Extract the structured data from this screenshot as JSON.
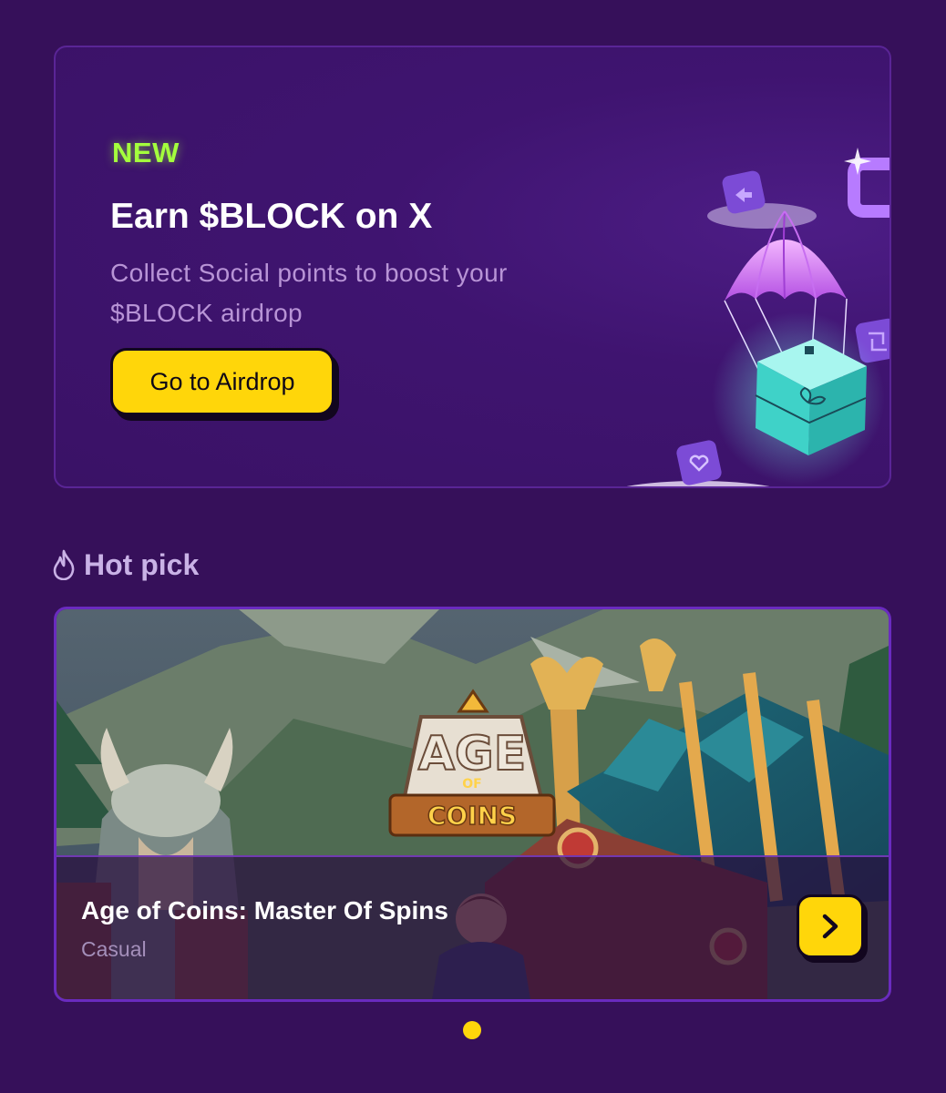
{
  "banner": {
    "badge": "NEW",
    "title": "Earn $BLOCK on X",
    "subtitle": "Collect Social points to boost your $BLOCK airdrop",
    "button_label": "Go to Airdrop"
  },
  "hot_pick": {
    "section_title": "Hot pick",
    "section_icon": "flame-icon",
    "game": {
      "title": "Age of Coins: Master Of Spins",
      "genre": "Casual",
      "logo": "AGE OF COINS",
      "action_icon": "chevron-right-icon"
    }
  },
  "carousel": {
    "active_index": 0,
    "count": 1
  },
  "colors": {
    "background": "#36105a",
    "accent": "#ffd60a",
    "new_badge": "#a4ff3d",
    "card_border": "#6a2bbf"
  }
}
